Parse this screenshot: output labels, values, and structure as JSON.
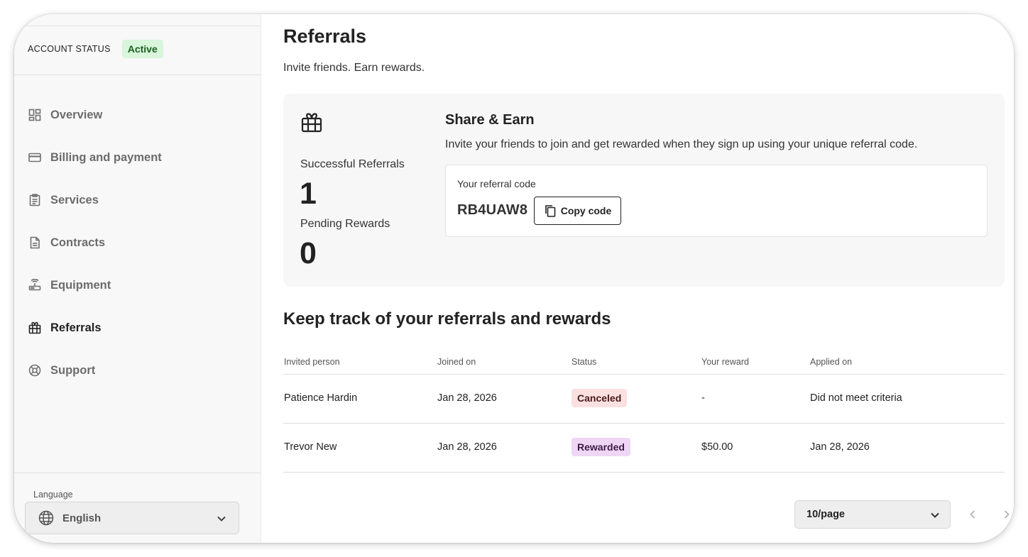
{
  "sidebar": {
    "account_status_label": "ACCOUNT STATUS",
    "account_status_value": "Active",
    "items": [
      {
        "label": "Overview",
        "icon": "dashboard-icon"
      },
      {
        "label": "Billing and payment",
        "icon": "credit-card-icon"
      },
      {
        "label": "Services",
        "icon": "clipboard-icon"
      },
      {
        "label": "Contracts",
        "icon": "document-icon"
      },
      {
        "label": "Equipment",
        "icon": "router-icon"
      },
      {
        "label": "Referrals",
        "icon": "gift-icon",
        "active": true
      },
      {
        "label": "Support",
        "icon": "lifebuoy-icon"
      }
    ],
    "language_label": "Language",
    "language_value": "English"
  },
  "main": {
    "title": "Referrals",
    "subtitle": "Invite friends. Earn rewards.",
    "stats": {
      "successful_label": "Successful Referrals",
      "successful_value": "1",
      "pending_label": "Pending Rewards",
      "pending_value": "0"
    },
    "share": {
      "title": "Share & Earn",
      "description": "Invite your friends to join and get rewarded when they sign up using your unique referral code.",
      "code_label": "Your referral code",
      "code_value": "RB4UAW8",
      "copy_label": "Copy code"
    },
    "section_title": "Keep track of your referrals and rewards",
    "table": {
      "headers": [
        "Invited person",
        "Joined on",
        "Status",
        "Your reward",
        "Applied on"
      ],
      "rows": [
        {
          "person": "Patience Hardin",
          "joined": "Jan 28, 2026",
          "status": "Canceled",
          "reward": "-",
          "applied": "Did not meet criteria"
        },
        {
          "person": "Trevor New",
          "joined": "Jan 28, 2026",
          "status": "Rewarded",
          "reward": "$50.00",
          "applied": "Jan 28, 2026"
        }
      ]
    },
    "pagination": {
      "page_size": "10/page"
    }
  },
  "colors": {
    "active_badge_bg": "#d9f5dc",
    "canceled_badge_bg": "#fbe0e0",
    "rewarded_badge_bg": "#efd6f5",
    "sidebar_bg": "#f8f8f8",
    "card_bg": "#f7f7f7"
  }
}
